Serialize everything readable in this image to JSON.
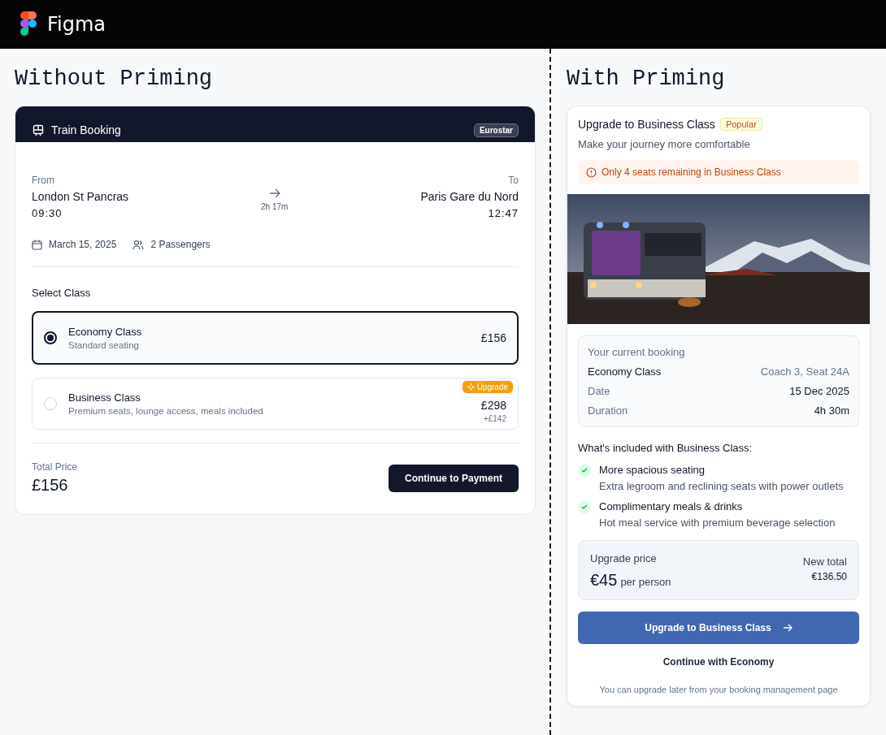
{
  "app": {
    "name": "Figma"
  },
  "left": {
    "heading": "Without Priming",
    "card": {
      "title": "Train Booking",
      "operator": "Eurostar",
      "from": {
        "label": "From",
        "station": "London St Pancras",
        "time": "09:30"
      },
      "duration": "2h 17m",
      "to": {
        "label": "To",
        "station": "Paris Gare du Nord",
        "time": "12:47"
      },
      "date": "March 15, 2025",
      "passengers": "2 Passengers",
      "section_title": "Select Class",
      "classes": [
        {
          "name": "Economy Class",
          "description": "Standard seating",
          "price": "£156",
          "selected": true
        },
        {
          "name": "Business Class",
          "description": "Premium seats, lounge access, meals included",
          "price": "£298",
          "difference": "+£142",
          "badge": "Upgrade",
          "selected": false
        }
      ],
      "total_label": "Total Price",
      "total": "£156",
      "button": "Continue to Payment"
    }
  },
  "right": {
    "heading": "With Priming",
    "card": {
      "title": "Upgrade to Business Class",
      "badge": "Popular",
      "subtitle": "Make your journey more comfortable",
      "alert": "Only 4 seats remaining in Business Class",
      "booking": {
        "title": "Your current booking",
        "rows": [
          {
            "kind": "header",
            "label": "Economy Class",
            "value": "Coach 3, Seat 24A"
          },
          {
            "kind": "detail",
            "label": "Date",
            "value": "15 Dec 2025"
          },
          {
            "kind": "detail",
            "label": "Duration",
            "value": "4h 30m"
          }
        ]
      },
      "features_title": "What's included with Business Class:",
      "features": [
        {
          "title": "More spacious seating",
          "description": "Extra legroom and reclining seats with power outlets"
        },
        {
          "title": "Complimentary meals & drinks",
          "description": "Hot meal service with premium beverage selection"
        }
      ],
      "price": {
        "label": "Upgrade price",
        "amount": "€45",
        "unit": "per person",
        "total_label": "New total",
        "total": "€136.50"
      },
      "primary_button": "Upgrade to Business Class",
      "secondary_button": "Continue with Economy",
      "note": "You can upgrade later from your booking management page"
    }
  }
}
